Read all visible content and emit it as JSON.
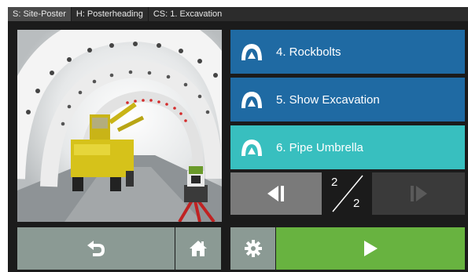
{
  "statusbar": {
    "site": "S: Site-Poster",
    "heading": "H: Posterheading",
    "control_set": "CS: 1. Excavation"
  },
  "menu": {
    "items": [
      {
        "label": "4. Rockbolts",
        "icon": "tunnel-icon",
        "state": "normal"
      },
      {
        "label": "5. Show Excavation",
        "icon": "tunnel-icon",
        "state": "normal"
      },
      {
        "label": "6. Pipe Umbrella",
        "icon": "tunnel-icon",
        "state": "selected"
      }
    ]
  },
  "pager": {
    "current": "2",
    "total": "2",
    "prev_icon": "previous-page-icon",
    "next_icon": "next-page-icon",
    "next_enabled": false
  },
  "toolbar": {
    "back_icon": "back-arrow-icon",
    "home_icon": "home-icon",
    "settings_icon": "gear-icon",
    "play_icon": "play-icon"
  },
  "colors": {
    "menu_blue": "#1f6aa3",
    "menu_selected": "#38bfbf",
    "button_gray": "#8b9a94",
    "play_green": "#68b340",
    "background": "#1b1b1b"
  }
}
